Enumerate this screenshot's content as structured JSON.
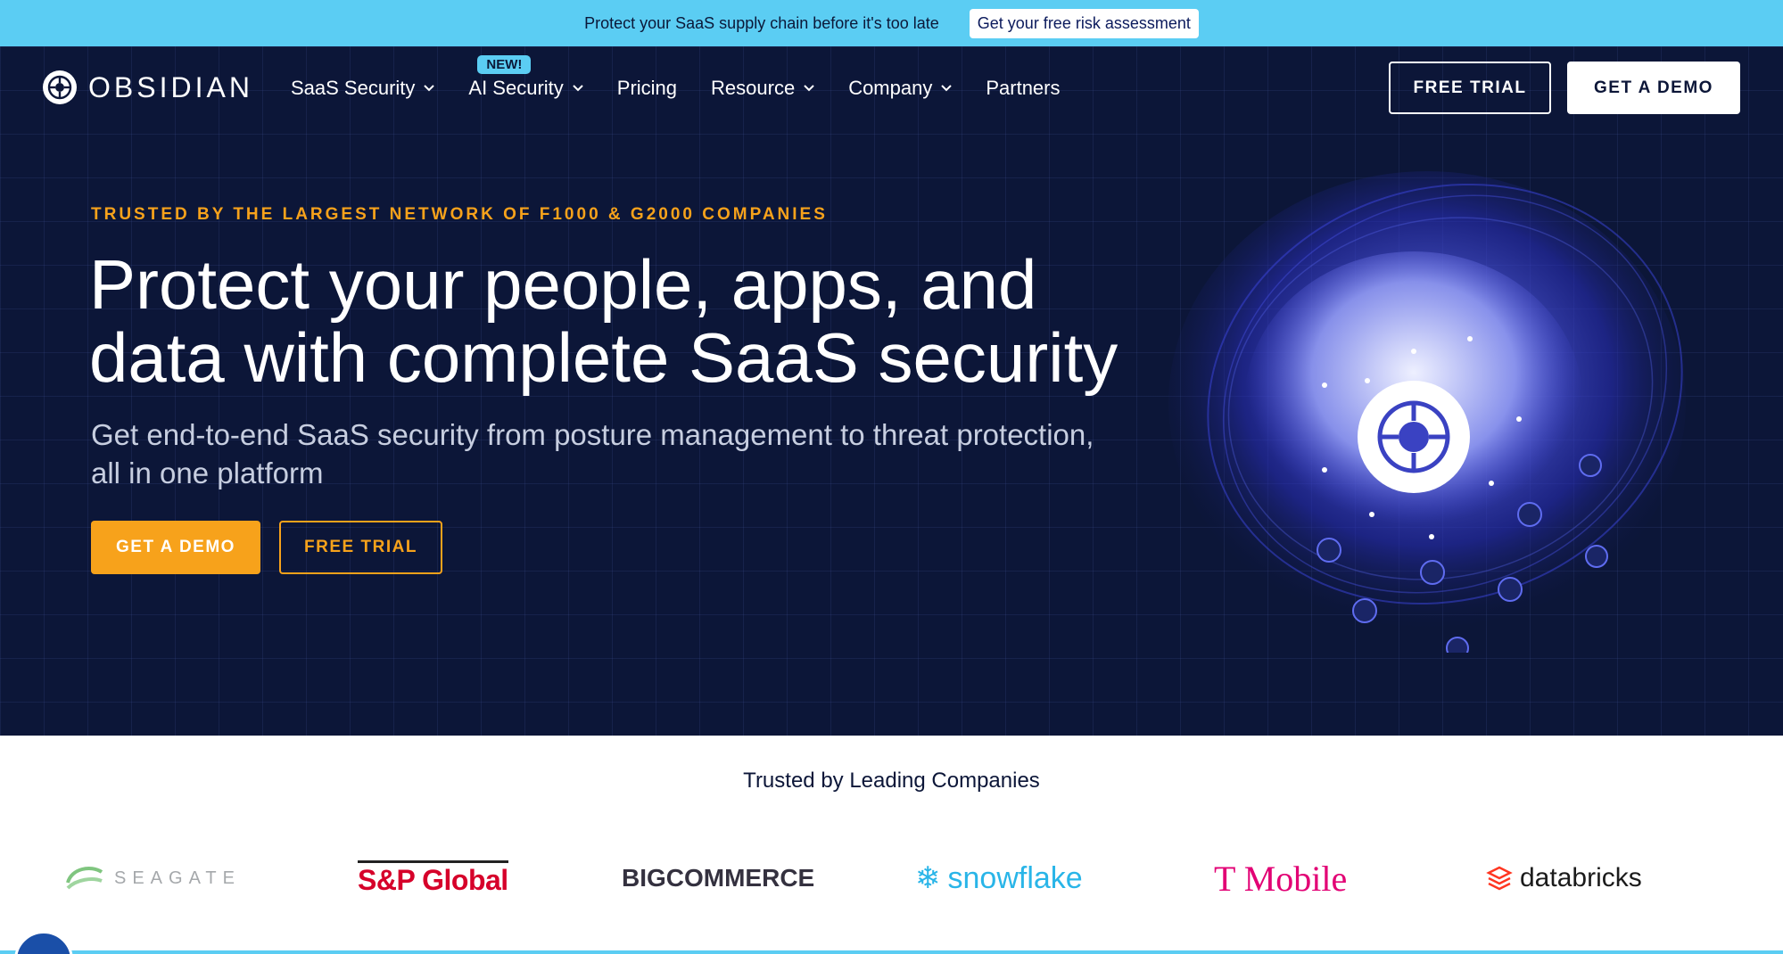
{
  "announcement": {
    "text": "Protect your SaaS supply chain before it's too late",
    "cta": "Get your free risk assessment"
  },
  "header": {
    "logo_text": "OBSIDIAN",
    "nav": [
      {
        "label": "SaaS Security",
        "has_dropdown": true
      },
      {
        "label": "AI Security",
        "has_dropdown": true,
        "badge": "NEW!"
      },
      {
        "label": "Pricing",
        "has_dropdown": false
      },
      {
        "label": "Resource",
        "has_dropdown": true
      },
      {
        "label": "Company",
        "has_dropdown": true
      },
      {
        "label": "Partners",
        "has_dropdown": false
      }
    ],
    "free_trial_label": "FREE TRIAL",
    "demo_label": "GET A DEMO"
  },
  "hero": {
    "eyebrow": "TRUSTED BY THE LARGEST NETWORK OF F1000 & G2000 COMPANIES",
    "headline_line1": "Protect your people, apps, and",
    "headline_line2": "data with complete SaaS security",
    "subhead_line1": "Get end-to-end SaaS security from posture management to threat protection,",
    "subhead_line2": "all in one platform",
    "primary_cta": "GET A DEMO",
    "secondary_cta": "FREE TRIAL"
  },
  "trusted": {
    "title": "Trusted by Leading Companies",
    "logos": [
      "SEAGATE",
      "S&P Global",
      "BIGCOMMERCE",
      "snowflake",
      "T Mobile",
      "databricks"
    ]
  },
  "colors": {
    "announce_bg": "#5bcdf3",
    "hero_bg": "#0c1638",
    "accent_orange": "#f7a21b"
  }
}
